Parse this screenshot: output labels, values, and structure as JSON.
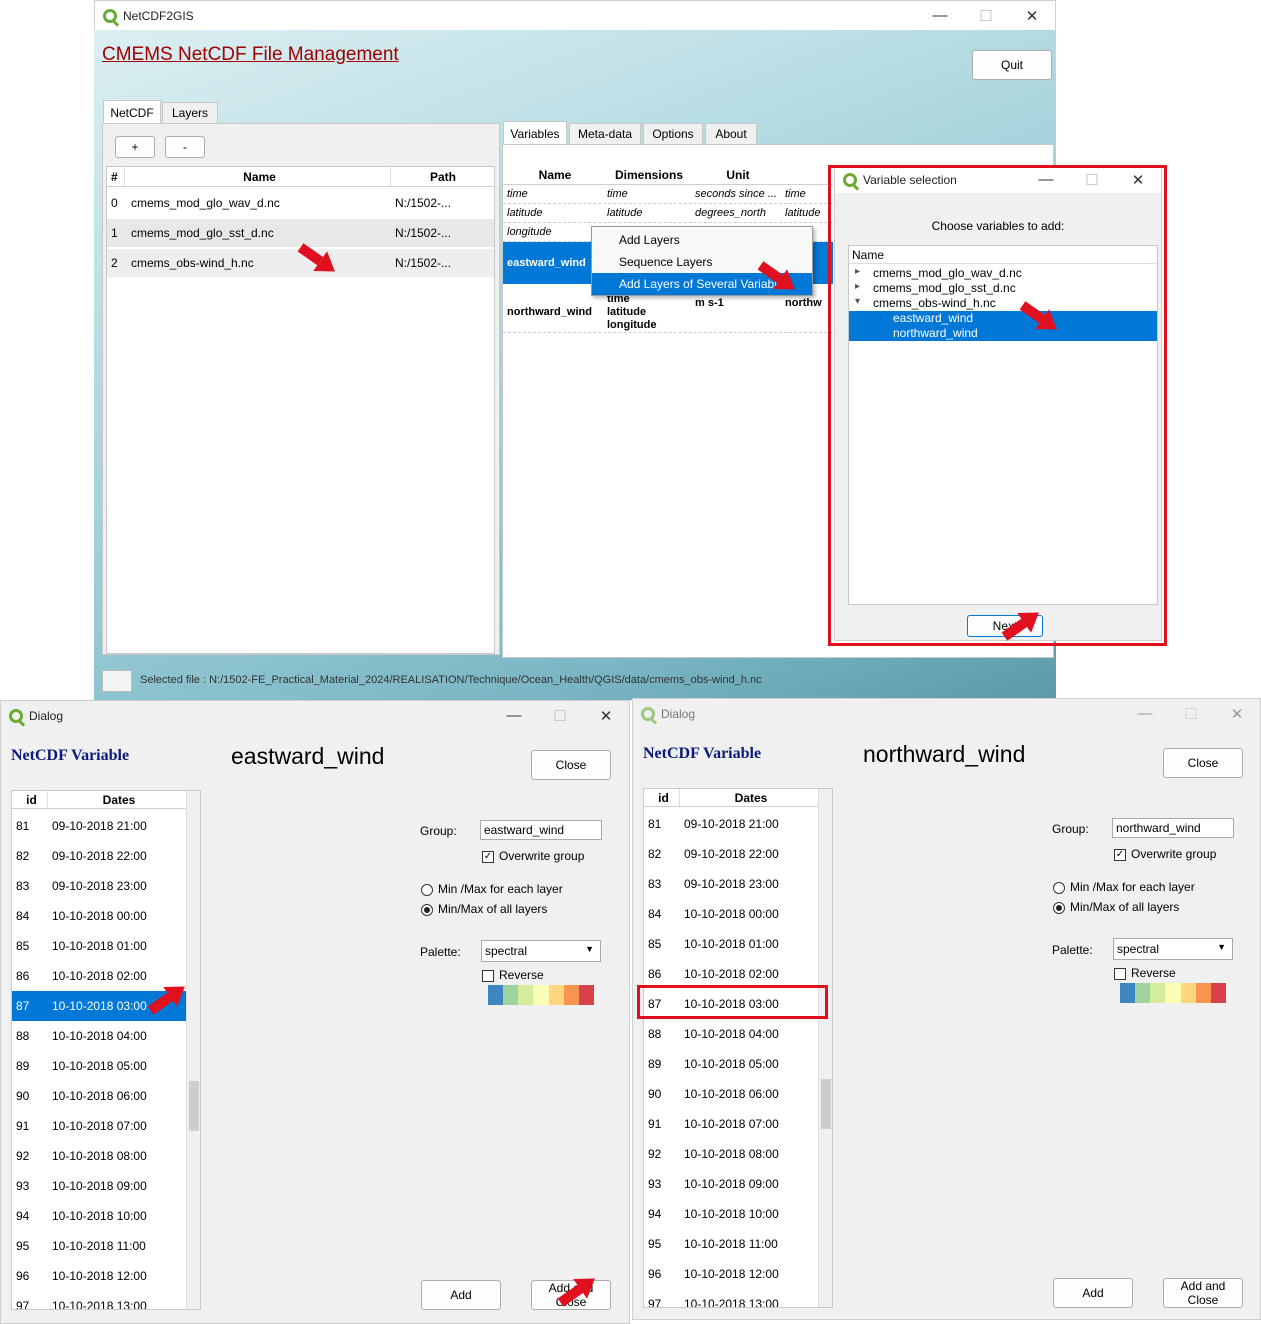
{
  "main": {
    "title": "NetCDF2GIS",
    "heading": "CMEMS NetCDF File Management",
    "quit": "Quit",
    "tabs": [
      "NetCDF",
      "Layers"
    ],
    "plus": "+",
    "minus": "-",
    "files_headers": [
      "#",
      "Name",
      "Path"
    ],
    "files": [
      {
        "id": "0",
        "name": "cmems_mod_glo_wav_d.nc",
        "path": "N:/1502-..."
      },
      {
        "id": "1",
        "name": "cmems_mod_glo_sst_d.nc",
        "path": "N:/1502-..."
      },
      {
        "id": "2",
        "name": "cmems_obs-wind_h.nc",
        "path": "N:/1502-..."
      }
    ],
    "right_tabs": [
      "Variables",
      "Meta-data",
      "Options",
      "About"
    ],
    "var_headers": [
      "Name",
      "Dimensions",
      "Unit"
    ],
    "vars": [
      {
        "name": "time",
        "dim": "time",
        "unit": "seconds since ...",
        "extra": "time"
      },
      {
        "name": "latitude",
        "dim": "latitude",
        "unit": "degrees_north",
        "extra": "latitude"
      },
      {
        "name": "longitude",
        "dim": "",
        "unit": "",
        "extra": ""
      }
    ],
    "eastward": "eastward_wind",
    "northward": "northward_wind",
    "northward_dims": [
      "time",
      "latitude",
      "longitude"
    ],
    "northward_unit": "m s-1",
    "northward_extra": "northw",
    "eastward_extra": "war",
    "context_menu": [
      "Add Layers",
      "Sequence Layers",
      "Add Layers of Several Variables"
    ],
    "status": "Selected file : N:/1502-FE_Practical_Material_2024/REALISATION/Technique/Ocean_Health/QGIS/data/cmems_obs-wind_h.nc"
  },
  "varsel": {
    "title": "Variable selection",
    "prompt": "Choose variables to add:",
    "tree_header": "Name",
    "items": [
      {
        "label": "cmems_mod_glo_wav_d.nc",
        "level": 0,
        "arrow": "▸"
      },
      {
        "label": "cmems_mod_glo_sst_d.nc",
        "level": 0,
        "arrow": "▸"
      },
      {
        "label": "cmems_obs-wind_h.nc",
        "level": 0,
        "arrow": "▾"
      },
      {
        "label": "eastward_wind",
        "level": 1,
        "arrow": ""
      },
      {
        "label": "northward_wind",
        "level": 1,
        "arrow": ""
      }
    ],
    "next": "Next"
  },
  "dialogs": [
    {
      "title": "Dialog",
      "heading": "NetCDF Variable",
      "var": "eastward_wind",
      "close": "Close",
      "group_label": "Group:",
      "group_value": "eastward_wind",
      "overwrite": "Overwrite group",
      "minmax_each": "Min /Max for each layer",
      "minmax_all": "Min/Max of all layers",
      "palette_label": "Palette:",
      "palette_value": "spectral",
      "reverse": "Reverse",
      "add": "Add",
      "add_close": "Add and Close"
    },
    {
      "title": "Dialog",
      "heading": "NetCDF Variable",
      "var": "northward_wind",
      "close": "Close",
      "group_label": "Group:",
      "group_value": "northward_wind",
      "overwrite": "Overwrite group",
      "minmax_each": "Min /Max for each layer",
      "minmax_all": "Min/Max of all layers",
      "palette_label": "Palette:",
      "palette_value": "spectral",
      "reverse": "Reverse",
      "add": "Add",
      "add_close": "Add and Close"
    }
  ],
  "dates_headers": [
    "id",
    "Dates"
  ],
  "dates": [
    {
      "id": "81",
      "d": "09-10-2018 21:00"
    },
    {
      "id": "82",
      "d": "09-10-2018 22:00"
    },
    {
      "id": "83",
      "d": "09-10-2018 23:00"
    },
    {
      "id": "84",
      "d": "10-10-2018 00:00"
    },
    {
      "id": "85",
      "d": "10-10-2018 01:00"
    },
    {
      "id": "86",
      "d": "10-10-2018 02:00"
    },
    {
      "id": "87",
      "d": "10-10-2018 03:00"
    },
    {
      "id": "88",
      "d": "10-10-2018 04:00"
    },
    {
      "id": "89",
      "d": "10-10-2018 05:00"
    },
    {
      "id": "90",
      "d": "10-10-2018 06:00"
    },
    {
      "id": "91",
      "d": "10-10-2018 07:00"
    },
    {
      "id": "92",
      "d": "10-10-2018 08:00"
    },
    {
      "id": "93",
      "d": "10-10-2018 09:00"
    },
    {
      "id": "94",
      "d": "10-10-2018 10:00"
    },
    {
      "id": "95",
      "d": "10-10-2018 11:00"
    },
    {
      "id": "96",
      "d": "10-10-2018 12:00"
    },
    {
      "id": "97",
      "d": "10-10-2018 13:00"
    }
  ],
  "palette_colors": [
    "#3e86c0",
    "#9ed39e",
    "#d4ec9b",
    "#fbfcb5",
    "#fed67f",
    "#f79550",
    "#d9414a"
  ],
  "accent": "#0078d7",
  "annotation_color": "#e0101e",
  "window_controls": [
    "—",
    "☐",
    "✕"
  ]
}
